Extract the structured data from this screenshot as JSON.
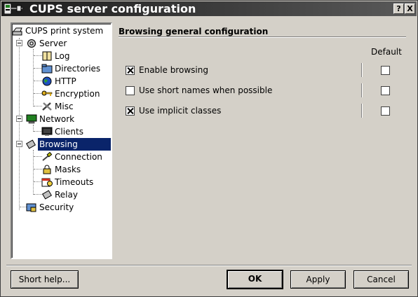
{
  "window": {
    "title": "CUPS server configuration",
    "help_btn": "?",
    "close_btn": "X"
  },
  "tree": {
    "root": "CUPS print system",
    "server": "Server",
    "server_children": [
      "Log",
      "Directories",
      "HTTP",
      "Encryption",
      "Misc"
    ],
    "network": "Network",
    "network_children": [
      "Clients"
    ],
    "browsing": "Browsing",
    "browsing_children": [
      "Connection",
      "Masks",
      "Timeouts",
      "Relay"
    ],
    "security": "Security",
    "selected": "Browsing"
  },
  "panel": {
    "title": "Browsing general configuration",
    "default_header": "Default",
    "options": [
      {
        "label": "Enable browsing",
        "checked": true,
        "default": false
      },
      {
        "label": "Use short names when possible",
        "checked": false,
        "default": false
      },
      {
        "label": "Use implicit classes",
        "checked": true,
        "default": false
      }
    ]
  },
  "buttons": {
    "short_help": "Short help...",
    "ok": "OK",
    "apply": "Apply",
    "cancel": "Cancel"
  },
  "colors": {
    "selection": "#0a246a",
    "window_bg": "#d4d0c8"
  }
}
